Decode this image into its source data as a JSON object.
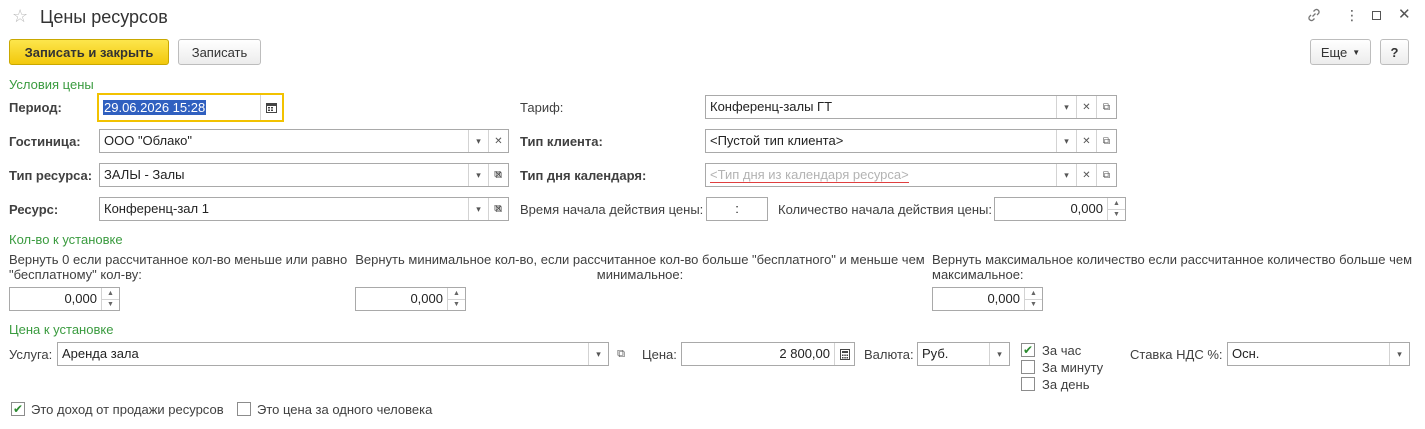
{
  "window": {
    "title": "Цены ресурсов"
  },
  "toolbar": {
    "save_close": "Записать и закрыть",
    "save": "Записать",
    "more": "Еще",
    "help": "?"
  },
  "conditions": {
    "header": "Условия цены",
    "period_label": "Период:",
    "period_value": "29.06.2026 15:28",
    "hotel_label": "Гостиница:",
    "hotel_value": "ООО \"Облако\"",
    "resource_type_label": "Тип ресурса:",
    "resource_type_value": "ЗАЛЫ - Залы",
    "resource_label": "Ресурс:",
    "resource_value": "Конференц-зал 1",
    "tariff_label": "Тариф:",
    "tariff_value": "Конференц-залы ГТ",
    "client_type_label": "Тип клиента:",
    "client_type_value": "<Пустой тип клиента>",
    "day_type_label": "Тип дня календаря:",
    "day_type_placeholder": "<Тип дня из календаря ресурса>",
    "start_time_label": "Время начала действия цены:",
    "start_time_value": ":",
    "start_qty_label": "Количество начала действия цены:",
    "start_qty_value": "0,000"
  },
  "quantity": {
    "header": "Кол-во к установке",
    "zero_label": "Вернуть 0 если рассчитанное кол-во меньше или равно \"бесплатному\" кол-ву:",
    "zero_value": "0,000",
    "min_label": "Вернуть минимальное кол-во, если рассчитанное кол-во больше \"бесплатного\" и меньше чем минимальное:",
    "min_value": "0,000",
    "max_label": "Вернуть максимальное количество если рассчитанное количество больше чем максимальное:",
    "max_value": "0,000"
  },
  "price": {
    "header": "Цена к установке",
    "service_label": "Услуга:",
    "service_value": "Аренда зала",
    "price_label": "Цена:",
    "price_value": "2 800,00",
    "currency_label": "Валюта:",
    "currency_value": "Руб.",
    "per_hour": "За час",
    "per_minute": "За минуту",
    "per_day": "За день",
    "vat_label": "Ставка НДС %:",
    "vat_value": "Осн."
  },
  "footer": {
    "revenue_label": "Это доход от продажи ресурсов",
    "per_person_label": "Это цена за одного человека"
  },
  "state": {
    "per_hour_checked": true,
    "per_minute_checked": false,
    "per_day_checked": false,
    "revenue_checked": true,
    "per_person_checked": false
  }
}
